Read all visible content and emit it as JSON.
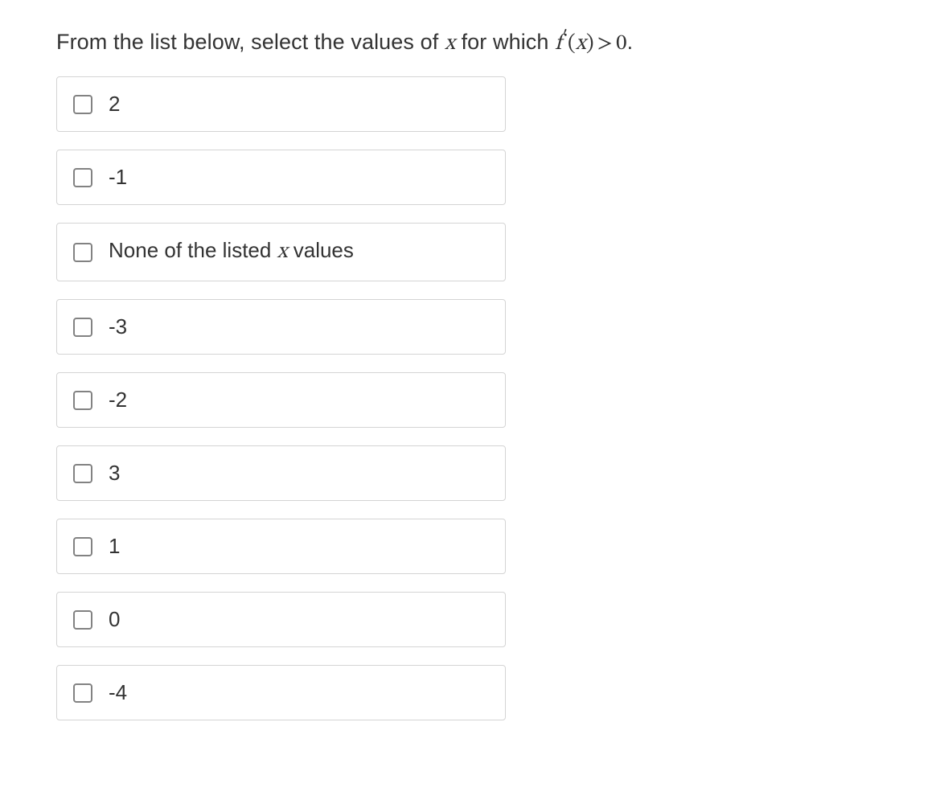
{
  "question": {
    "prefix": "From the list below, select the values of ",
    "var1": "x",
    "middle": " for which ",
    "func_name": "f",
    "func_arg": "x",
    "operator": ">",
    "rhs": "0",
    "suffix": "."
  },
  "options": [
    {
      "label": "2",
      "has_math": false
    },
    {
      "label": "-1",
      "has_math": false
    },
    {
      "prefix": "None of the listed ",
      "var": "x",
      "suffix": " values",
      "has_math": true
    },
    {
      "label": "-3",
      "has_math": false
    },
    {
      "label": "-2",
      "has_math": false
    },
    {
      "label": "3",
      "has_math": false
    },
    {
      "label": "1",
      "has_math": false
    },
    {
      "label": "0",
      "has_math": false
    },
    {
      "label": "-4",
      "has_math": false
    }
  ]
}
